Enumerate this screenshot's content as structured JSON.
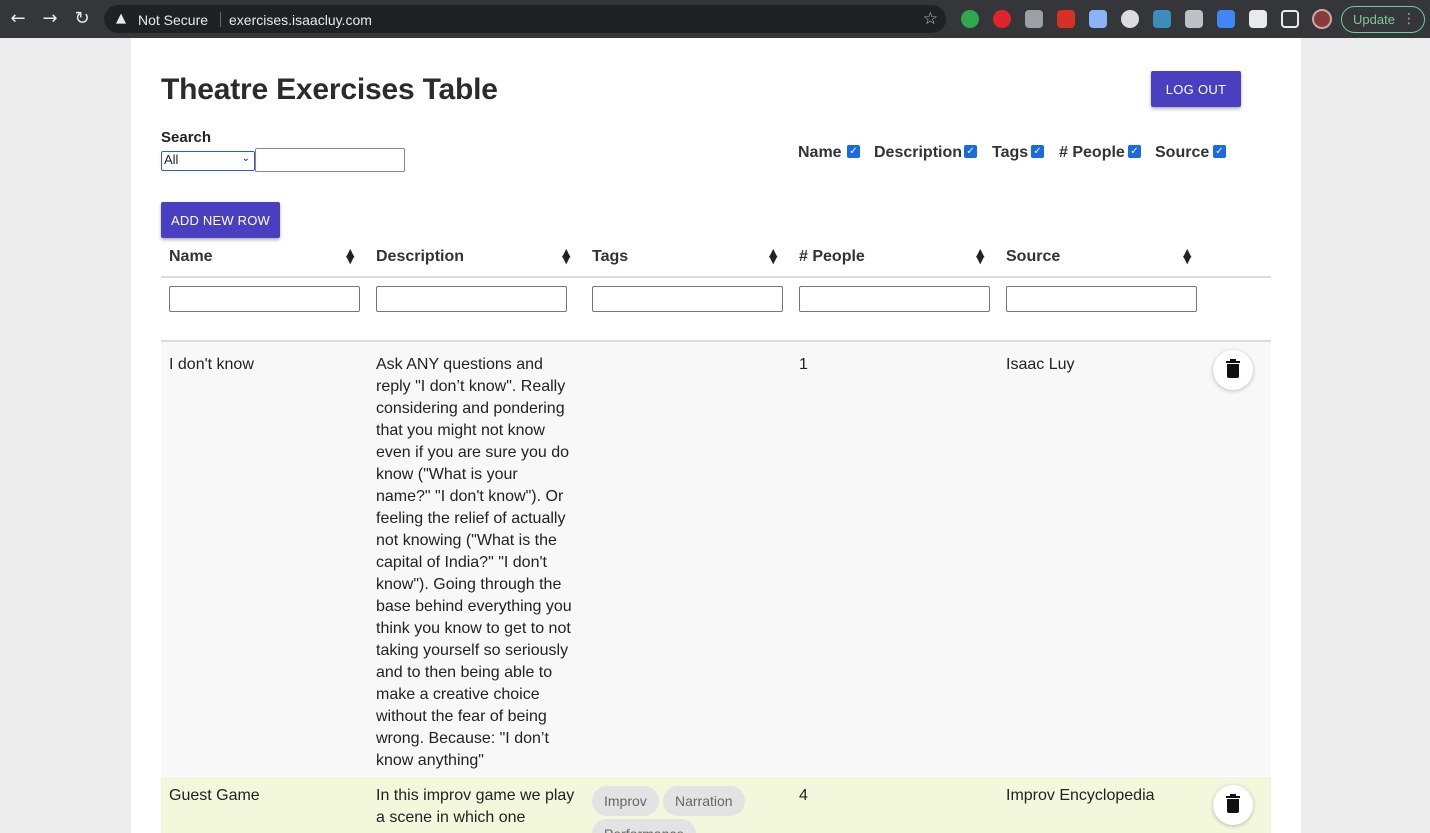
{
  "browser": {
    "not_secure_label": "Not Secure",
    "url": "exercises.isaacluy.com",
    "update_label": "Update"
  },
  "page": {
    "title": "Theatre Exercises Table",
    "logout_label": "LOG OUT",
    "search_label": "Search",
    "search_scope": "All",
    "add_row_label": "ADD NEW ROW"
  },
  "column_toggles": [
    {
      "label": "Name",
      "checked": true
    },
    {
      "label": "Description",
      "checked": true
    },
    {
      "label": "Tags",
      "checked": true
    },
    {
      "label": "# People",
      "checked": true
    },
    {
      "label": "Source",
      "checked": true
    }
  ],
  "table": {
    "headers": [
      "Name",
      "Description",
      "Tags",
      "# People",
      "Source"
    ],
    "rows": [
      {
        "name": "I don't know",
        "description": "Ask ANY questions and reply \"I don’t know\". Really considering and pondering that you might not know even if you are sure you do know (\"What is your name?\" \"I don't know\"). Or feeling the relief of actually not knowing (\"What is the capital of India?\" \"I don't know\"). Going through the base behind everything you think you know to get to not taking yourself so seriously and to then being able to make a creative choice without the fear of being wrong. Because: \"I don’t know anything\"",
        "tags": [],
        "people": "1",
        "source": "Isaac Luy"
      },
      {
        "name": "Guest Game",
        "description": "In this improv game we play a scene in which one",
        "tags": [
          "Improv",
          "Narration",
          "Performance"
        ],
        "people": "4",
        "source": "Improv Encyclopedia"
      }
    ]
  },
  "icons": {
    "sort": "sort-icon",
    "delete": "trash-icon"
  }
}
